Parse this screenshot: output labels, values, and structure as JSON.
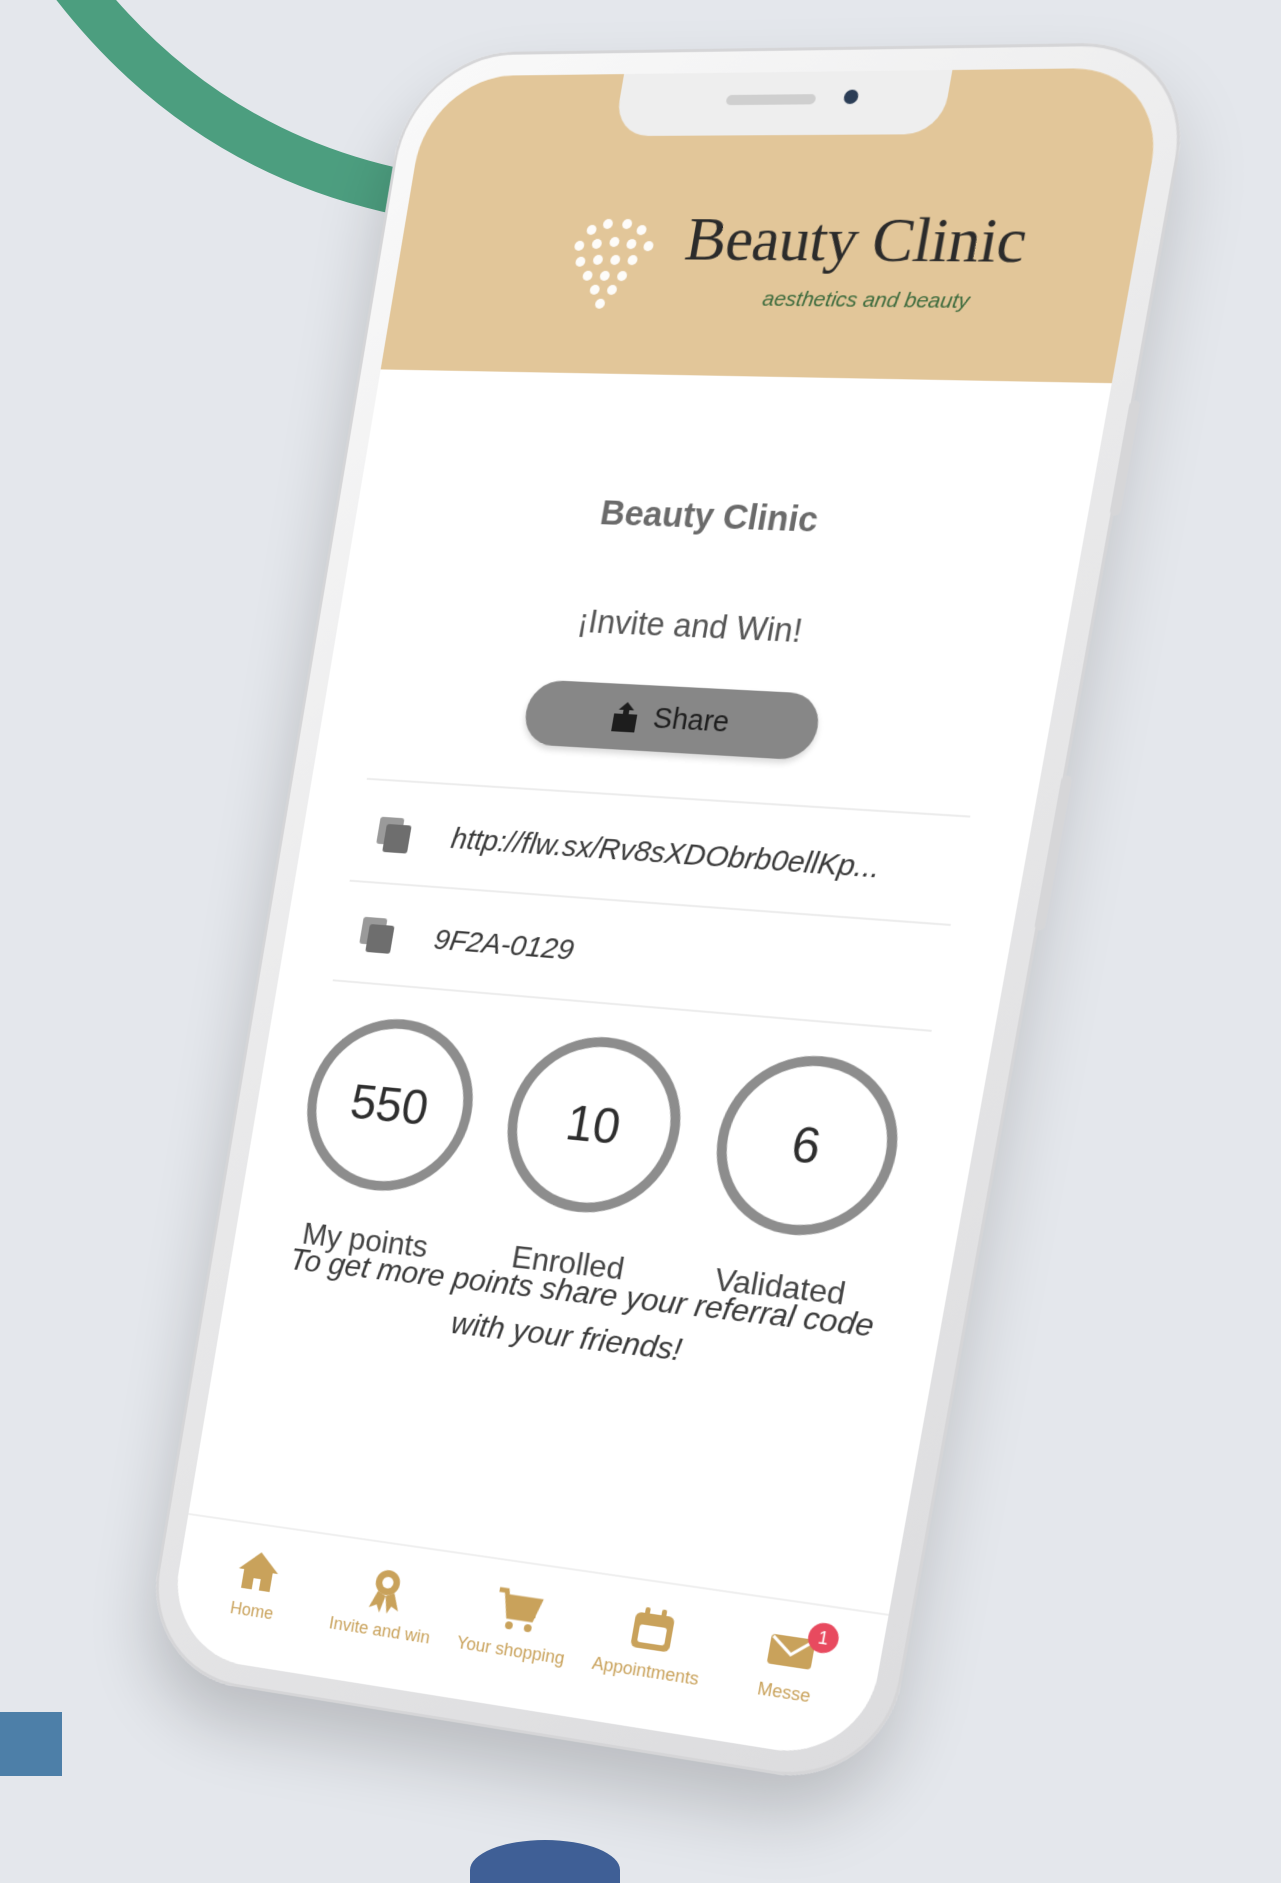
{
  "colors": {
    "header_bg": "#e2c699",
    "accent_gold": "#c9a25b",
    "ring_gray": "#8d8d8d",
    "share_button_bg": "#878787",
    "badge_red": "#e84a5f",
    "deco_green": "#4c9e7f",
    "deco_blue": "#4d7fa8"
  },
  "header": {
    "brand_name": "Beauty Clinic",
    "tagline": "aesthetics and beauty",
    "logo_icon": "heart-of-sparkles-icon"
  },
  "main": {
    "clinic_title": "Beauty Clinic",
    "invite_title": "¡Invite and Win!",
    "share_button": {
      "label": "Share",
      "icon": "share-upload-icon"
    },
    "referral_link": "http://flw.sx/Rv8sXDObrb0ellKp...",
    "referral_code": "9F2A-0129",
    "copy_icon": "copy-icon"
  },
  "stats": [
    {
      "value": "550",
      "label": "My points"
    },
    {
      "value": "10",
      "label": "Enrolled"
    },
    {
      "value": "6",
      "label": "Validated"
    }
  ],
  "hint": "To get more points share your referral code with your friends!",
  "nav": {
    "items": [
      {
        "label": "Home",
        "icon": "home-icon"
      },
      {
        "label": "Invite and win",
        "icon": "award-icon"
      },
      {
        "label": "Your shopping",
        "icon": "cart-icon"
      },
      {
        "label": "Appointments",
        "icon": "calendar-icon"
      },
      {
        "label": "Messe",
        "icon": "mail-icon",
        "badge": "1"
      }
    ]
  }
}
